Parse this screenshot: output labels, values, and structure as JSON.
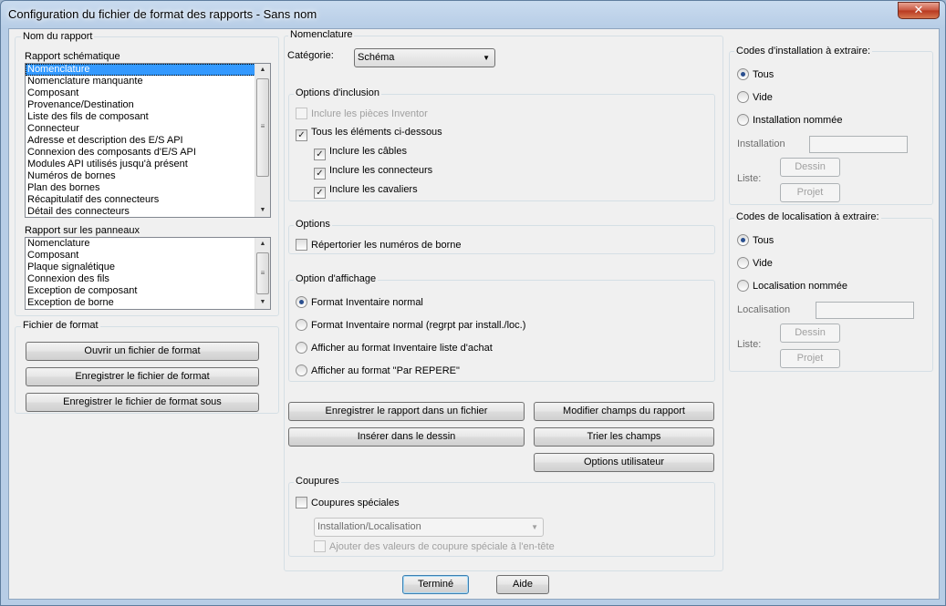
{
  "window": {
    "title": "Configuration du fichier de format des rapports - Sans nom",
    "close_glyph": "✕"
  },
  "report_name": {
    "group_label": "Nom du rapport",
    "schematic_label": "Rapport schématique",
    "schematic_items": [
      "Nomenclature",
      "Nomenclature manquante",
      "Composant",
      "Provenance/Destination",
      "Liste des fils de composant",
      "Connecteur",
      "Adresse et description des E/S API",
      "Connexion des composants d'E/S API",
      "Modules API utilisés jusqu'à présent",
      "Numéros de bornes",
      "Plan des bornes",
      "Récapitulatif des connecteurs",
      "Détail des connecteurs"
    ],
    "schematic_selected": "Nomenclature",
    "panel_label": "Rapport sur les panneaux",
    "panel_items": [
      "Nomenclature",
      "Composant",
      "Plaque signalétique",
      "Connexion des fils",
      "Exception de composant",
      "Exception de borne"
    ]
  },
  "format_file": {
    "group_label": "Fichier de format",
    "open_label": "Ouvrir un fichier de format",
    "save_label": "Enregistrer le fichier de format",
    "save_as_label": "Enregistrer le fichier de format sous"
  },
  "nomenclature": {
    "section_label": "Nomenclature",
    "category_label": "Catégorie:",
    "category_value": "Schéma",
    "inclusion": {
      "group_label": "Options d'inclusion",
      "inventor_label": "Inclure les pièces Inventor",
      "all_label": "Tous les éléments ci-dessous",
      "cables_label": "Inclure les câbles",
      "connectors_label": "Inclure les connecteurs",
      "jumpers_label": "Inclure les cavaliers"
    },
    "options": {
      "group_label": "Options",
      "terminal_numbers_label": "Répertorier les numéros de borne"
    },
    "display": {
      "group_label": "Option d'affichage",
      "opt1": "Format Inventaire normal",
      "opt2": "Format Inventaire normal (regrpt par install./loc.)",
      "opt3": "Afficher au format Inventaire liste d'achat",
      "opt4": "Afficher au format \"Par REPERE\""
    },
    "actions": {
      "save_report": "Enregistrer le rapport dans un fichier",
      "insert": "Insérer dans le dessin",
      "modify_fields": "Modifier champs du rapport",
      "sort_fields": "Trier les champs",
      "user_options": "Options utilisateur"
    },
    "breaks": {
      "group_label": "Coupures",
      "special_label": "Coupures spéciales",
      "combo_value": "Installation/Localisation",
      "header_label": "Ajouter des valeurs de coupure spéciale à l'en-tête"
    }
  },
  "install_codes": {
    "group_label": "Codes d'installation à extraire:",
    "all": "Tous",
    "empty": "Vide",
    "named": "Installation nommée",
    "field_label": "Installation",
    "list_label": "Liste:",
    "drawing_btn": "Dessin",
    "project_btn": "Projet"
  },
  "location_codes": {
    "group_label": "Codes de localisation à extraire:",
    "all": "Tous",
    "empty": "Vide",
    "named": "Localisation nommée",
    "field_label": "Localisation",
    "list_label": "Liste:",
    "drawing_btn": "Dessin",
    "project_btn": "Projet"
  },
  "footer": {
    "done_label": "Terminé",
    "help_label": "Aide"
  },
  "glyphs": {
    "check": "✓",
    "arrow_up": "▲",
    "arrow_down": "▼",
    "grip": "≡"
  }
}
